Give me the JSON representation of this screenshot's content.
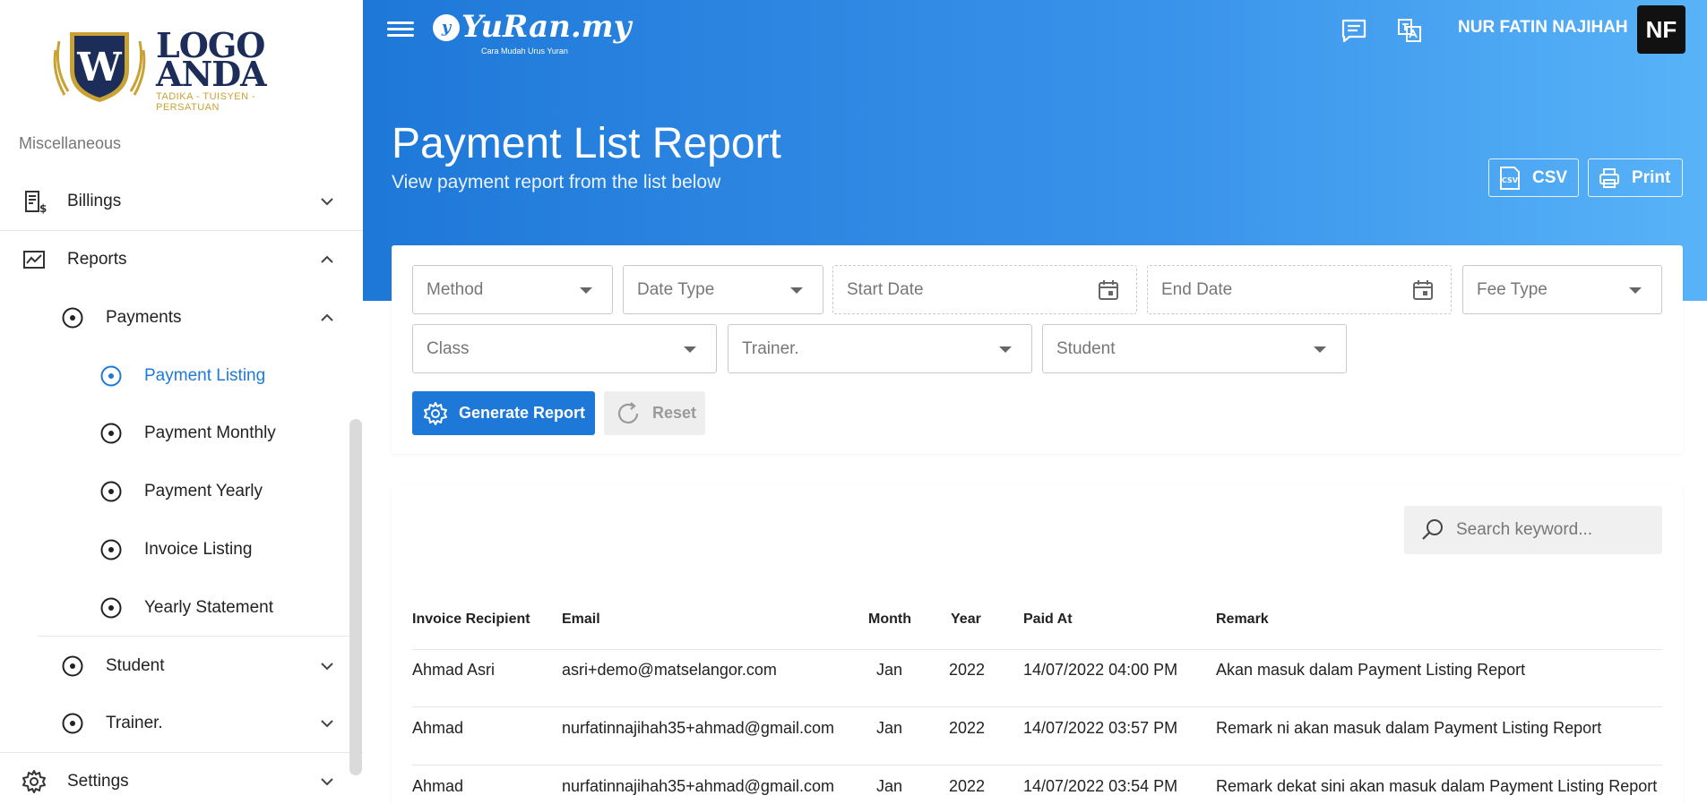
{
  "logo": {
    "line1": "LOGO",
    "line2": "ANDA",
    "emblem_letter": "W",
    "tagline": "TADIKA - TUISYEN - PERSATUAN"
  },
  "sidebar": {
    "section_title": "Miscellaneous",
    "items": [
      {
        "label": "Billings",
        "icon": "billing-icon",
        "expanded": false
      },
      {
        "label": "Reports",
        "icon": "reports-icon",
        "expanded": true
      },
      {
        "label": "Payments",
        "icon": "radio-icon",
        "expanded": true
      },
      {
        "label": "Payment Listing",
        "icon": "radio-icon",
        "active": true
      },
      {
        "label": "Payment Monthly",
        "icon": "radio-icon"
      },
      {
        "label": "Payment Yearly",
        "icon": "radio-icon"
      },
      {
        "label": "Invoice Listing",
        "icon": "radio-icon"
      },
      {
        "label": "Yearly Statement",
        "icon": "radio-icon"
      },
      {
        "label": "Student",
        "icon": "radio-icon",
        "expanded": false
      },
      {
        "label": "Trainer.",
        "icon": "radio-icon",
        "expanded": false
      },
      {
        "label": "Settings",
        "icon": "gear-icon",
        "expanded": false
      }
    ]
  },
  "header": {
    "brand_name": "YuRan.my",
    "brand_icon_letter": "y",
    "brand_tagline": "Cara Mudah Urus Yuran",
    "user_name": "NUR FATIN NAJIHAH",
    "avatar_initials": "NF",
    "page_title": "Payment List Report",
    "page_subtitle": "View payment report from the list below",
    "csv_label": "CSV",
    "csv_icon_text": "CSV",
    "print_label": "Print"
  },
  "filters": {
    "method": "Method",
    "date_type": "Date Type",
    "start_date": "Start Date",
    "end_date": "End Date",
    "fee_type": "Fee Type",
    "class": "Class",
    "trainer": "Trainer.",
    "student": "Student",
    "generate_label": "Generate Report",
    "reset_label": "Reset"
  },
  "table": {
    "search_placeholder": "Search keyword...",
    "headers": [
      "Invoice Recipient",
      "Email",
      "Month",
      "Year",
      "Paid At",
      "Remark"
    ],
    "rows": [
      [
        "Ahmad Asri",
        "asri+demo@matselangor.com",
        "Jan",
        "2022",
        "14/07/2022 04:00 PM",
        "Akan masuk dalam Payment Listing Report"
      ],
      [
        "Ahmad",
        "nurfatinnajihah35+ahmad@gmail.com",
        "Jan",
        "2022",
        "14/07/2022 03:57 PM",
        "Remark ni akan masuk dalam Payment Listing Report"
      ],
      [
        "Ahmad",
        "nurfatinnajihah35+ahmad@gmail.com",
        "Jan",
        "2022",
        "14/07/2022 03:54 PM",
        "Remark dekat sini akan masuk dalam Payment Listing Report"
      ]
    ]
  },
  "colors": {
    "accent": "#1e78d8",
    "active_text": "#1e7ad7",
    "header_gradient_end": "#58b3f8"
  }
}
